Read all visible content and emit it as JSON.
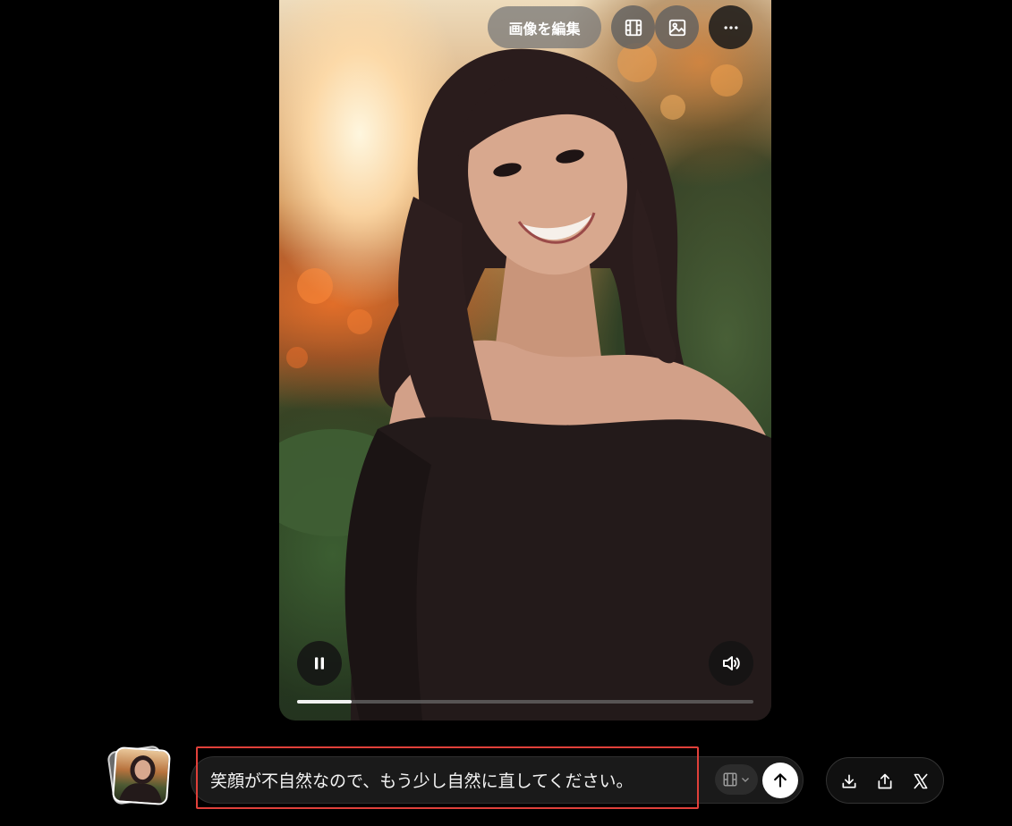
{
  "video": {
    "edit_image_label": "画像を編集",
    "toolbar_icons": [
      "video-icon",
      "image-icon",
      "more-icon"
    ],
    "playback_icons": [
      "pause-icon",
      "volume-icon"
    ],
    "progress": 0.12
  },
  "prompt": {
    "text": "笑顔が不自然なので、もう少し自然に直してください。",
    "mode_icon": "video-icon",
    "send_icon": "arrow-up-icon"
  },
  "actions": {
    "icons": [
      "download-icon",
      "share-icon",
      "x-logo-icon"
    ]
  },
  "colors": {
    "background": "#000000",
    "highlight_border": "#e0403a",
    "prompt_bar": "#1a1a1a"
  }
}
